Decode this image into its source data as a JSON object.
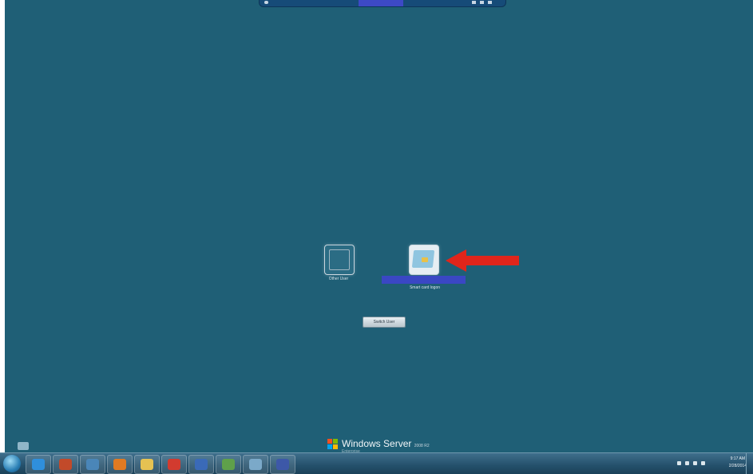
{
  "login_screen": {
    "tiles": [
      {
        "label": "Other User",
        "icon": "user-frame-icon"
      },
      {
        "label": "Smart card logon",
        "icon": "smart-card-icon"
      }
    ],
    "switch_user_label": "Switch User",
    "annotation": {
      "icon": "red-arrow-icon",
      "color": "#e0251b"
    }
  },
  "branding": {
    "product": "Windows Server",
    "version": "2008 R2",
    "edition": "Enterprise"
  },
  "taskbar": {
    "clock_time": "9:17 AM",
    "clock_date": "2/28/2014",
    "pinned": [
      {
        "name": "internet-explorer",
        "color": "#2f8fdc"
      },
      {
        "name": "server-manager",
        "color": "#c24a2a"
      },
      {
        "name": "remote-desktop",
        "color": "#4a86b8"
      },
      {
        "name": "firefox",
        "color": "#e07a22"
      },
      {
        "name": "file-explorer",
        "color": "#e6c252"
      },
      {
        "name": "adobe-reader",
        "color": "#d23b2f"
      },
      {
        "name": "powershell",
        "color": "#3a6ab8"
      },
      {
        "name": "management-console",
        "color": "#5fa04a"
      },
      {
        "name": "network-tool",
        "color": "#7ba9c9"
      },
      {
        "name": "remote-session",
        "color": "#3d58a8"
      }
    ]
  },
  "colors": {
    "desktop": "#1f5f76",
    "selection": "#3a47c4",
    "accent_red": "#e0251b"
  }
}
